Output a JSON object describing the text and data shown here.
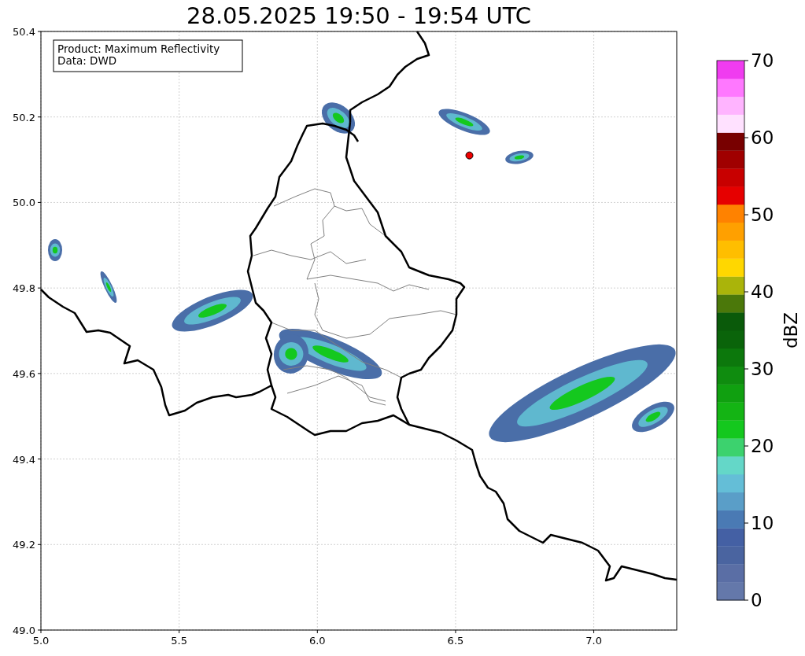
{
  "title": "28.05.2025 19:50 - 19:54 UTC",
  "legend": {
    "lines": [
      "Product: Maximum Reflectivity",
      "Data: DWD"
    ]
  },
  "map": {
    "xticks": [
      "5.0",
      "5.5",
      "6.0",
      "6.5",
      "7.0"
    ],
    "yticks": [
      "50.4",
      "50.2",
      "50.0",
      "49.8",
      "49.6",
      "49.4",
      "49.2",
      "49.0"
    ]
  },
  "colorbar": {
    "label": "dBZ",
    "ticks": [
      "70",
      "60",
      "50",
      "40",
      "30",
      "20",
      "10",
      "0"
    ],
    "bands": [
      {
        "color": "#6478aa"
      },
      {
        "color": "#5a6ea5"
      },
      {
        "color": "#4a64a0"
      },
      {
        "color": "#4460a4"
      },
      {
        "color": "#4a7ab4"
      },
      {
        "color": "#5a9ec8"
      },
      {
        "color": "#64bed7"
      },
      {
        "color": "#64d7c8"
      },
      {
        "color": "#3cd26e"
      },
      {
        "color": "#14c81e"
      },
      {
        "color": "#14b414"
      },
      {
        "color": "#10a010"
      },
      {
        "color": "#0f8c0f"
      },
      {
        "color": "#0c780c"
      },
      {
        "color": "#0a640a"
      },
      {
        "color": "#0a5a0a"
      },
      {
        "color": "#4b780a"
      },
      {
        "color": "#aab40a"
      },
      {
        "color": "#ffd700"
      },
      {
        "color": "#ffbe00"
      },
      {
        "color": "#ffa000"
      },
      {
        "color": "#ff8200"
      },
      {
        "color": "#e60000"
      },
      {
        "color": "#c80000"
      },
      {
        "color": "#a00000"
      },
      {
        "color": "#780000"
      },
      {
        "color": "#ffe1ff"
      },
      {
        "color": "#ffb4ff"
      },
      {
        "color": "#ff78ff"
      },
      {
        "color": "#f03cf0"
      }
    ]
  }
}
